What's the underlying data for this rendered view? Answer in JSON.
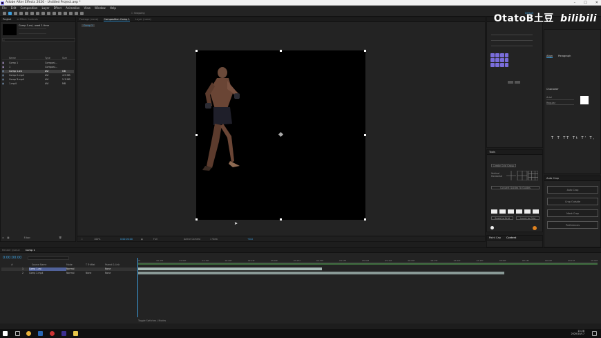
{
  "window": {
    "title": "Adobe After Effects 2020 - Untitled Project.aep *"
  },
  "menu": [
    "File",
    "Edit",
    "Composition",
    "Layer",
    "Effect",
    "Animation",
    "View",
    "Window",
    "Help"
  ],
  "workspace": {
    "label": "Default"
  },
  "watermark": {
    "text": "OtatoB土豆",
    "brand": "bilibili"
  },
  "project": {
    "tab": "Project",
    "selected_name": "Comp 1.avi",
    "selected_info": "used 1 time",
    "columns": [
      "Name",
      "Type",
      "Size"
    ],
    "items": [
      {
        "name": "Comp 1",
        "type": "Composi...",
        "size": ""
      },
      {
        "name": "1",
        "type": "Composi...",
        "size": ""
      },
      {
        "name": "Comp 1.avi",
        "type": "AVI",
        "size": "GB"
      },
      {
        "name": "Comp 2.mp4",
        "type": "AVI",
        "size": "4.9 MB"
      },
      {
        "name": "Comp 3.mp4",
        "type": "AVI",
        "size": "5.3 MB"
      },
      {
        "name": "1.mp4",
        "type": "AVI",
        "size": "MB"
      }
    ],
    "bpc": "8 bpc"
  },
  "comp_panel": {
    "tabs": [
      "Footage (none)",
      "Composition Comp 1",
      "Layer (none)"
    ],
    "breadcrumb": "Comp 1",
    "zoom": "100%",
    "timecode": "0:00:00:00",
    "resolution": "Full",
    "camera": "Active Camera",
    "views": "1 View"
  },
  "timeline": {
    "tab": "Comp 1",
    "render_queue": "Render Queue",
    "timecode": "0:00:00:00",
    "columns": [
      "Source Name",
      "Mode",
      "T TrkMat",
      "Parent & Link"
    ],
    "layers": [
      {
        "num": "1",
        "name": "Comp 1.avi",
        "mode": "Normal",
        "trkmat": "",
        "parent": "None"
      },
      {
        "num": "2",
        "name": "Comp 2.mp4",
        "mode": "Normal",
        "trkmat": "None",
        "parent": "None"
      }
    ],
    "ruler": [
      "0f",
      "00:15f",
      "01:00f",
      "01:15f",
      "02:00f",
      "02:15f",
      "03:00f",
      "03:15f",
      "04:00f",
      "04:15f",
      "05:00f",
      "05:15f",
      "06:00f",
      "06:15f",
      "07:00f",
      "07:15f",
      "08:00f",
      "08:15f",
      "09:00f",
      "09:15f",
      "10:00f"
    ],
    "footer": "Toggle Switches / Modes"
  },
  "right_panel": {
    "character_tab": "Character",
    "font": "Arial",
    "style": "Regular",
    "align_tab": "Align",
    "paragraph_tab": "Paragraph",
    "tools_label": "Tools",
    "auto_crop_tab": "Auto Crop",
    "auto_crop_btn": "Auto Crop",
    "crop_outside_btn": "Crop Outside",
    "mask_crop_btn": "Mask Crop",
    "preferences_btn": "Preferences",
    "create_grid_btn": "Create Grid Group",
    "convert_btn": "Convert Guides To Guides",
    "scale_btn": "Scale to Grid",
    "invert_btn": "Invert to Grid",
    "grid_options": [
      "Vertical",
      "Horizontal"
    ],
    "paint_tab": "Paint Cap",
    "content_tab": "Content"
  },
  "taskbar": {
    "time": "13:28",
    "date": "2020/10/17"
  }
}
